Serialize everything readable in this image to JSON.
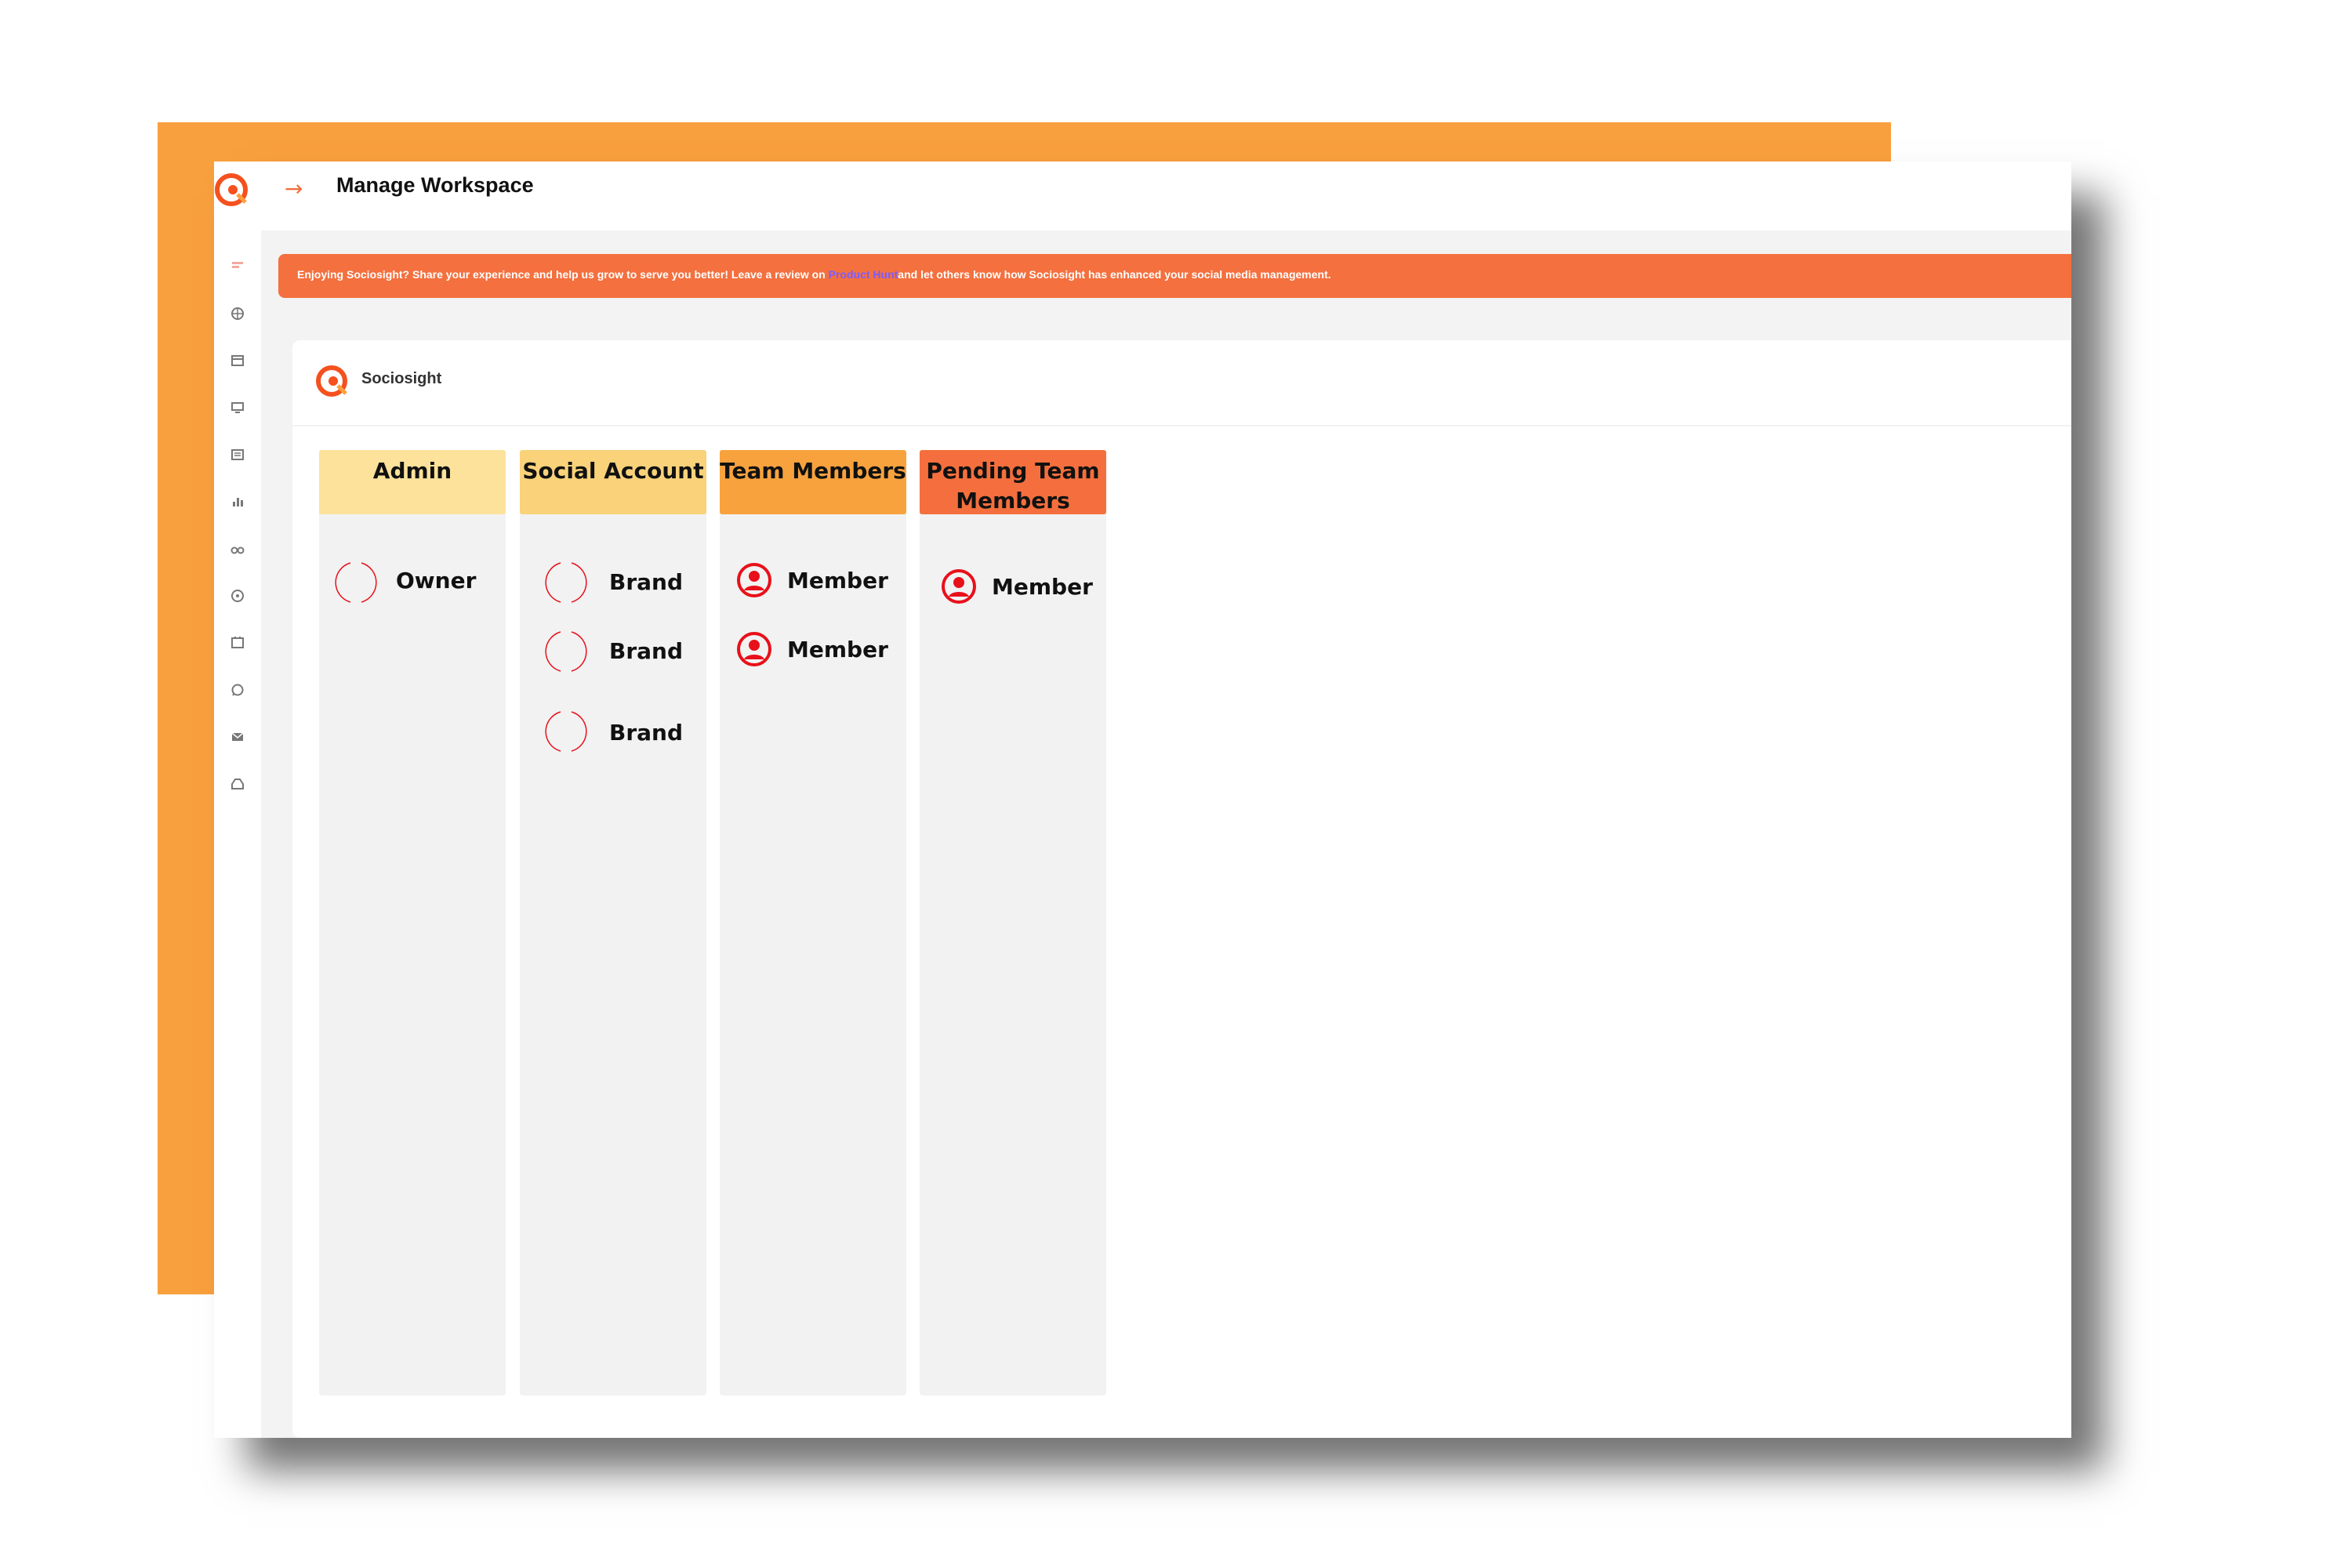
{
  "header": {
    "title": "Manage Workspace",
    "back_arrow": "→"
  },
  "banner": {
    "text_before": "Enjoying Sociosight? Share your experience and help us grow to serve you better! Leave a review on ",
    "link_text": "Product Hunt",
    "text_after": "and let others know how Sociosight has enhanced your social media management."
  },
  "brand": {
    "name": "Sociosight"
  },
  "sidebar": {
    "icons": [
      "dashboard-icon",
      "globe-icon",
      "calendar-icon",
      "monitor-icon",
      "feed-icon",
      "bar-chart-icon",
      "binoculars-icon",
      "compass-icon",
      "planner-icon",
      "whatsapp-icon",
      "mail-icon",
      "inbox-icon"
    ]
  },
  "columns": [
    {
      "title": "Admin",
      "color": "#FCE29A",
      "items": [
        {
          "label": "Owner",
          "icon": "avatar-ring-icon"
        }
      ]
    },
    {
      "title": "Social Account",
      "color": "#F9D27A",
      "items": [
        {
          "label": "Brand",
          "icon": "avatar-ring-icon"
        },
        {
          "label": "Brand",
          "icon": "avatar-ring-icon"
        },
        {
          "label": "Brand",
          "icon": "avatar-ring-icon"
        }
      ]
    },
    {
      "title": "Team Members",
      "color": "#F8A23E",
      "items": [
        {
          "label": "Member",
          "icon": "user-icon"
        },
        {
          "label": "Member",
          "icon": "user-icon"
        }
      ]
    },
    {
      "title": "Pending Team Members",
      "title_line1": "Pending Team",
      "title_line2": "Members",
      "color": "#F46F3D",
      "items": [
        {
          "label": "Member",
          "icon": "user-icon"
        }
      ]
    }
  ],
  "colors": {
    "accent_orange": "#F9A03E",
    "banner_orange": "#F4703E",
    "icon_red": "#E8101A"
  }
}
